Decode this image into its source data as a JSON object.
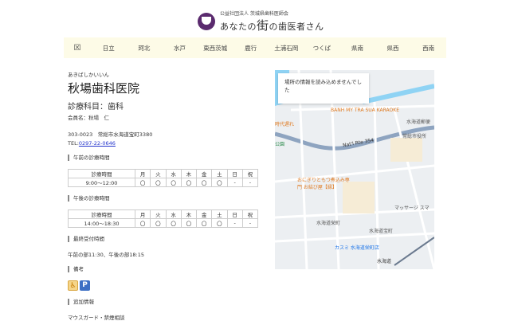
{
  "header": {
    "org": "公益社団法人 茨城県歯科医師会",
    "site_title_pre": "あなたの",
    "site_title_big": "街",
    "site_title_post": "の歯医者さん"
  },
  "nav": {
    "home_icon": "map-icon",
    "items": [
      "日立",
      "珂北",
      "水戸",
      "東西茨城",
      "鹿行",
      "土浦石岡",
      "つくば",
      "県南",
      "県西",
      "西南"
    ]
  },
  "clinic": {
    "kana": "あきばしかいいん",
    "name": "秋場歯科医院",
    "department": "診療科目：歯科",
    "member": "会員名：秋場　仁",
    "address": "303-0023　常総市水海道宝町3380",
    "tel_label": "TEL:",
    "tel": "0297-22-0646"
  },
  "am": {
    "heading": "午前の診療時間",
    "header": [
      "診療時間",
      "月",
      "火",
      "水",
      "木",
      "金",
      "土",
      "日",
      "祝"
    ],
    "row": [
      "9:00～12:00",
      "〇",
      "〇",
      "〇",
      "〇",
      "〇",
      "〇",
      "-",
      "-"
    ]
  },
  "pm": {
    "heading": "午後の診療時間",
    "header": [
      "診療時間",
      "月",
      "火",
      "水",
      "木",
      "金",
      "土",
      "日",
      "祝"
    ],
    "row": [
      "14:00～18:30",
      "〇",
      "〇",
      "〇",
      "〇",
      "〇",
      "〇",
      "-",
      "-"
    ]
  },
  "last": {
    "heading": "最終受付時間",
    "text": "午前の部11:30、午後の部18:15"
  },
  "notes": {
    "heading": "備考",
    "icons": [
      "wheelchair-icon",
      "parking-icon"
    ],
    "parking_text": "P",
    "wheelchair_text": "♿"
  },
  "extra": {
    "heading": "追加情報",
    "text": "マウスガード・禁煙相談"
  },
  "map": {
    "error": "場所の情報を読み込めませんでした",
    "labels": [
      "BANH MY TRA SUA KARAOKE",
      "水海道郵便",
      "常総市役所",
      "Nat'l Rte 354",
      "時代遅れ",
      "公園",
      "おにぎりともつ煮込み専門 お結び屋【縁】",
      "水海道栄町",
      "水海道宝町",
      "カスミ 水海道栄町店",
      "マッサージ スマ",
      "水海道"
    ]
  }
}
